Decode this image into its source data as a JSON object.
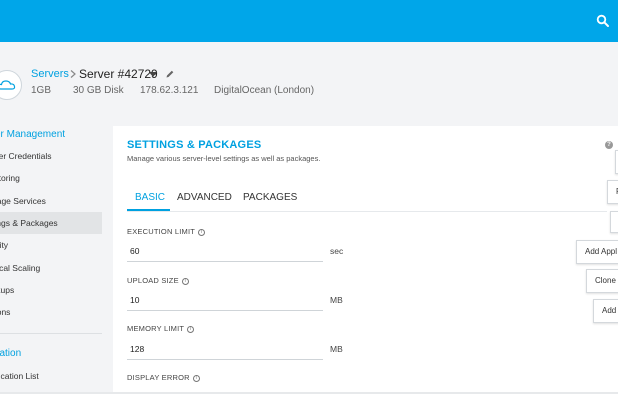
{
  "header": {
    "servers_link": "Servers",
    "server_name": "Server #42729",
    "meta": {
      "ram": "1GB",
      "disk": "30 GB Disk",
      "ip": "178.62.3.121",
      "provider": "DigitalOcean (London)"
    }
  },
  "sidebar": {
    "server_section": "ver Management",
    "items": [
      "ster Credentials",
      "nitoring",
      "nage Services",
      "tings & Packages",
      "urity",
      "rtical Scaling",
      "ckups",
      "dons"
    ],
    "active_index": 3,
    "app_section": "lication",
    "app_items": [
      "plication List"
    ]
  },
  "panel": {
    "title": "SETTINGS & PACKAGES",
    "subtitle": "Manage various server-level settings as well as packages.",
    "help": "?",
    "tabs": [
      "BASIC",
      "ADVANCED",
      "PACKAGES"
    ],
    "active_tab": "BASIC",
    "fields": [
      {
        "label": "EXECUTION LIMIT",
        "value": "60",
        "unit": "sec"
      },
      {
        "label": "UPLOAD SIZE",
        "value": "10",
        "unit": "MB"
      },
      {
        "label": "MEMORY LIMIT",
        "value": "128",
        "unit": "MB"
      },
      {
        "label": "DISPLAY ERROR"
      }
    ],
    "info_glyph": "i"
  },
  "right_actions": {
    "add_app": "Add Appl",
    "clone": "Clone",
    "add": "Add",
    "partial_r": "F"
  },
  "icons": {
    "search": "search-icon",
    "logo": "cloud-logo-icon",
    "separator": "chevron-right-icon",
    "caret": "caret-down-icon",
    "edit": "pencil-icon",
    "help": "help-icon",
    "info": "info-icon"
  },
  "colors": {
    "brand": "#00a6e9",
    "accent": "#00a1e0",
    "background": "#f3f4f6"
  }
}
